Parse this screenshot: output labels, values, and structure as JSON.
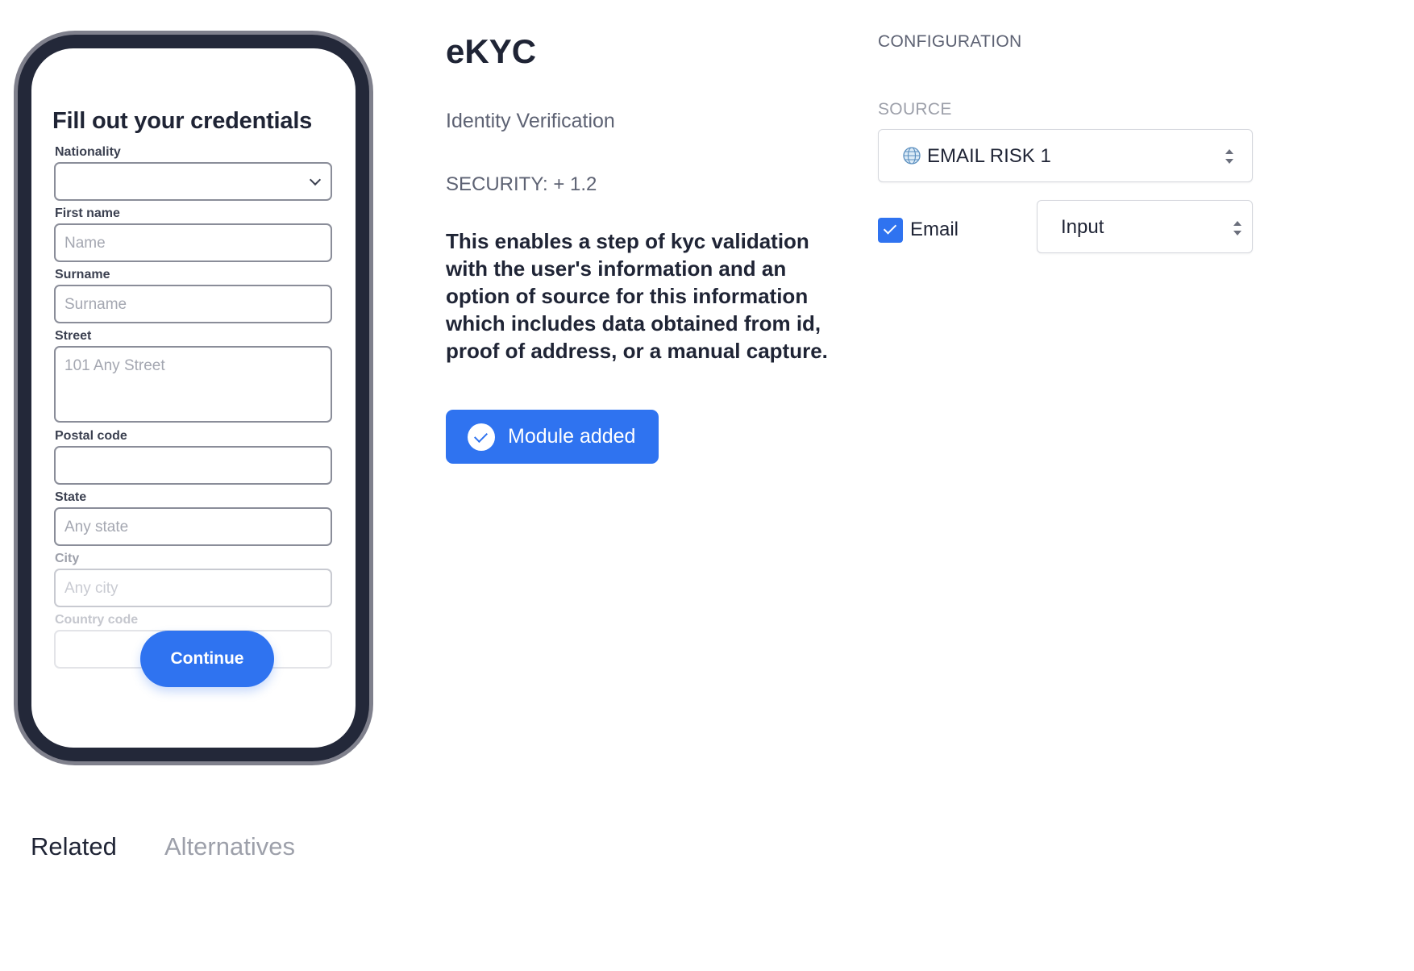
{
  "preview": {
    "form_title": "Fill out your credentials",
    "fields": [
      {
        "label": "Nationality",
        "placeholder": ""
      },
      {
        "label": "First name",
        "placeholder": "Name"
      },
      {
        "label": "Surname",
        "placeholder": "Surname"
      },
      {
        "label": "Street",
        "placeholder": "101 Any Street"
      },
      {
        "label": "Postal code",
        "placeholder": ""
      },
      {
        "label": "State",
        "placeholder": "Any state"
      },
      {
        "label": "City",
        "placeholder": "Any city"
      },
      {
        "label": "Country code",
        "placeholder": ""
      }
    ],
    "continue_label": "Continue"
  },
  "module": {
    "title": "eKYC",
    "subtitle": "Identity Verification",
    "security": "SECURITY: + 1.2",
    "description": "This enables a step of kyc validation with the user's information and an option of source for this information which includes data obtained from id, proof of address, or a manual capture.",
    "status_button": "Module added"
  },
  "configuration": {
    "heading": "CONFIGURATION",
    "source_label": "SOURCE",
    "source_value": "EMAIL RISK 1",
    "source_icon": "globe-icon",
    "email_checked": true,
    "email_label": "Email",
    "email_input_type": "Input"
  },
  "tabs": [
    {
      "label": "Related",
      "active": true
    },
    {
      "label": "Alternatives",
      "active": false
    }
  ],
  "colors": {
    "accent": "#2f73f0",
    "text_dark": "#1f2435",
    "text_muted": "#5d6273",
    "phone_frame": "#232839"
  }
}
